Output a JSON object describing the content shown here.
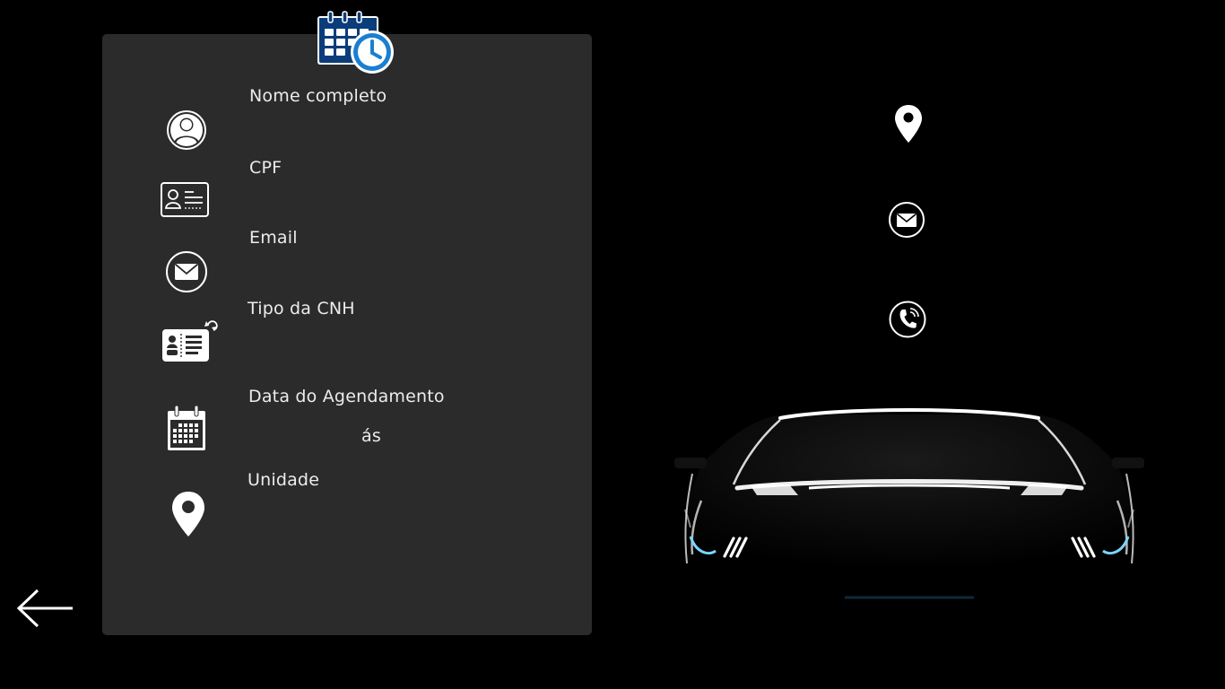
{
  "form": {
    "fields": [
      {
        "label": "Nome completo",
        "icon": "user-icon"
      },
      {
        "label": "CPF",
        "icon": "id-card-icon"
      },
      {
        "label": "Email",
        "icon": "envelope-icon"
      },
      {
        "label": "Tipo da CNH",
        "icon": "driver-license-icon"
      },
      {
        "label": "Data do Agendamento",
        "icon": "calendar-icon"
      },
      {
        "label": "Unidade",
        "icon": "location-pin-icon"
      }
    ],
    "time_separator": "ás"
  },
  "header_icon": "calendar-clock-icon",
  "contact_icons": [
    "location-pin-icon",
    "envelope-icon",
    "phone-icon"
  ],
  "colors": {
    "background": "#000000",
    "card": "#2b2b2b",
    "accent_blue": "#0a3d7a",
    "clock_blue": "#1a7fd1"
  }
}
